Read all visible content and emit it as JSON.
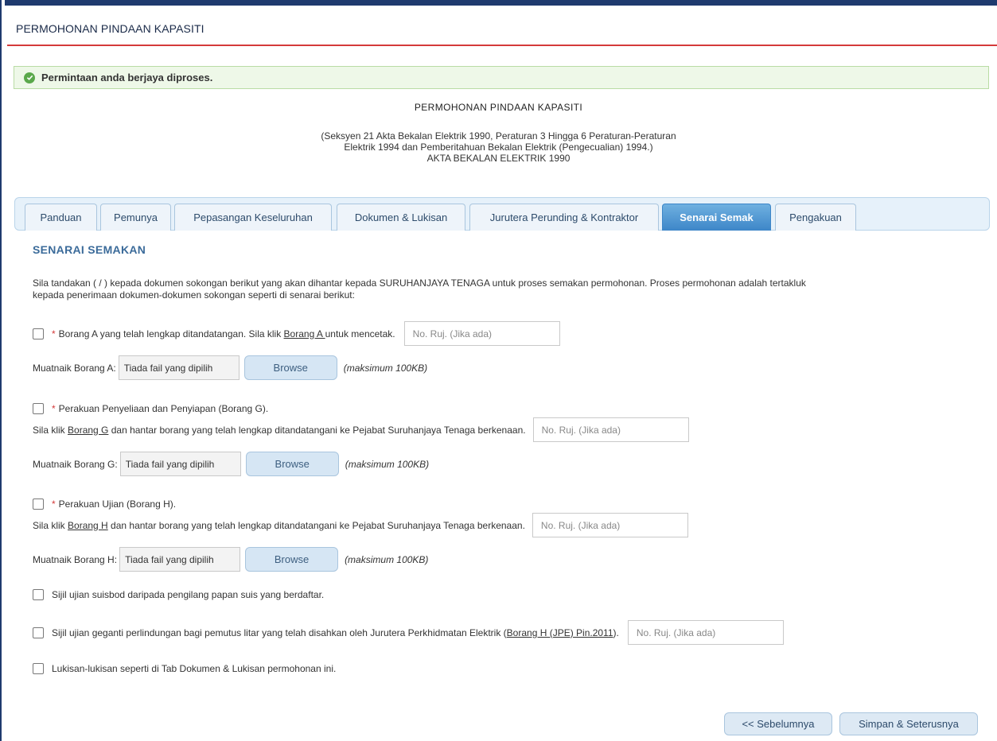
{
  "page": {
    "title": "PERMOHONAN PINDAAN KAPASITI"
  },
  "alert": {
    "message": "Permintaan anda berjaya diproses.",
    "icon": "check-circle-icon",
    "color": "#5aa84b"
  },
  "document": {
    "title": "PERMOHONAN PINDAAN KAPASITI",
    "subtitle_lines": [
      "(Seksyen 21 Akta Bekalan Elektrik 1990, Peraturan 3 Hingga 6 Peraturan-Peraturan",
      "Elektrik 1994 dan Pemberitahuan Bekalan Elektrik (Pengecualian) 1994.)",
      "AKTA BEKALAN ELEKTRIK 1990"
    ]
  },
  "tabs": [
    {
      "label": "Panduan",
      "active": false
    },
    {
      "label": "Pemunya",
      "active": false
    },
    {
      "label": "Pepasangan Keseluruhan",
      "active": false
    },
    {
      "label": "Dokumen & Lukisan",
      "active": false
    },
    {
      "label": "Jurutera Perunding & Kontraktor",
      "active": false
    },
    {
      "label": "Senarai Semak",
      "active": true
    },
    {
      "label": "Pengakuan",
      "active": false
    }
  ],
  "section": {
    "title": "SENARAI SEMAKAN",
    "intro_lines": [
      "Sila tandakan ( / ) kepada dokumen sokongan berikut yang akan dihantar kepada SURUHANJAYA TENAGA untuk proses semakan permohonan. Proses permohonan adalah tertakluk",
      "kepada penerimaan dokumen-dokumen sokongan seperti di senarai berikut:"
    ]
  },
  "ref_placeholder": "No. Ruj. (Jika ada)",
  "file_placeholder": "Tiada fail yang dipilih",
  "browse_label": "Browse",
  "max_size_hint": "(maksimum 100KB)",
  "checklist": {
    "borang_a": {
      "required_mark": "*",
      "text_before": "Borang A yang telah lengkap ditandatangan. Sila klik ",
      "link": "Borang A ",
      "text_after": "untuk mencetak.",
      "upload_label": "Muatnaik Borang A:"
    },
    "borang_g": {
      "required_mark": "*",
      "text": "Perakuan Penyeliaan dan Penyiapan (Borang G).",
      "line2_before": "Sila klik ",
      "link": "Borang G",
      "line2_after": " dan hantar borang yang telah lengkap ditandatangani ke Pejabat Suruhanjaya Tenaga berkenaan.",
      "upload_label": "Muatnaik Borang G:"
    },
    "borang_h": {
      "required_mark": "*",
      "text": "Perakuan Ujian (Borang H).",
      "line2_before": "Sila klik ",
      "link": "Borang H",
      "line2_after": " dan hantar borang yang telah lengkap ditandatangani ke Pejabat Suruhanjaya Tenaga berkenaan.",
      "upload_label": "Muatnaik Borang H:"
    },
    "sijil_suisbod": {
      "text": "Sijil ujian suisbod daripada pengilang papan suis yang berdaftar."
    },
    "sijil_geganti": {
      "text_before": "Sijil ujian geganti perlindungan bagi pemutus litar yang telah disahkan oleh Jurutera Perkhidmatan Elektrik (",
      "link": "Borang H (JPE) Pin.2011",
      "text_after": ")."
    },
    "lukisan": {
      "text": "Lukisan-lukisan seperti di Tab Dokumen & Lukisan permohonan ini."
    }
  },
  "buttons": {
    "previous": "<< Sebelumnya",
    "save_next": "Simpan & Seterusnya"
  }
}
